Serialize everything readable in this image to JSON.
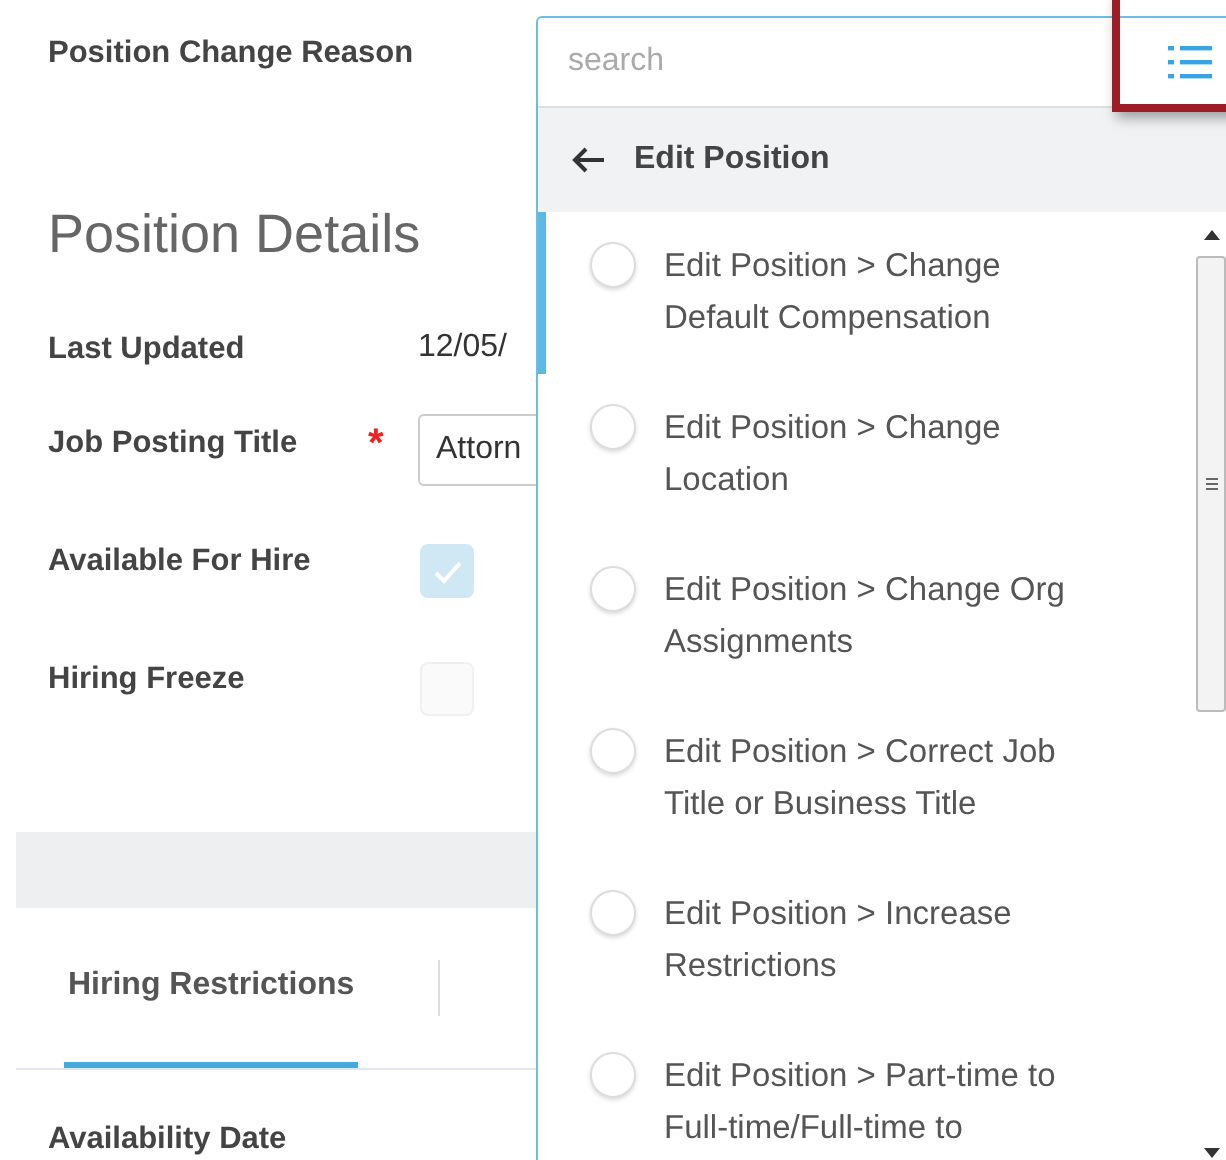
{
  "form": {
    "change_reason_label": "Position Change Reason"
  },
  "section_title": "Position Details",
  "fields": [
    {
      "kind": "text",
      "label": "Last Updated",
      "value": "12/05/"
    },
    {
      "kind": "input",
      "label": "Job Posting Title",
      "required_mark": "*",
      "value": "Attorn"
    },
    {
      "kind": "checkbox",
      "label": "Available For Hire",
      "checked": true
    },
    {
      "kind": "checkbox",
      "label": "Hiring Freeze",
      "checked": false
    }
  ],
  "tabs": [
    {
      "label": "Hiring Restrictions",
      "selected": true
    }
  ],
  "next_label": "Availability Date",
  "dropdown": {
    "search": {
      "placeholder": "search"
    },
    "highlighted_button": true,
    "back_label": "Edit Position",
    "options": [
      {
        "label": "Edit Position > Change Default Compensation",
        "selected": false,
        "focused": true
      },
      {
        "label": "Edit Position > Change Location",
        "selected": false,
        "focused": false
      },
      {
        "label": "Edit Position > Change Org Assignments",
        "selected": false,
        "focused": false
      },
      {
        "label": "Edit Position > Correct Job Title or Business Title",
        "selected": false,
        "focused": false
      },
      {
        "label": "Edit Position > Increase Restrictions",
        "selected": false,
        "focused": false
      },
      {
        "label": "Edit Position > Part-time to Full-time/Full-time to",
        "selected": false,
        "focused": false
      }
    ]
  }
}
